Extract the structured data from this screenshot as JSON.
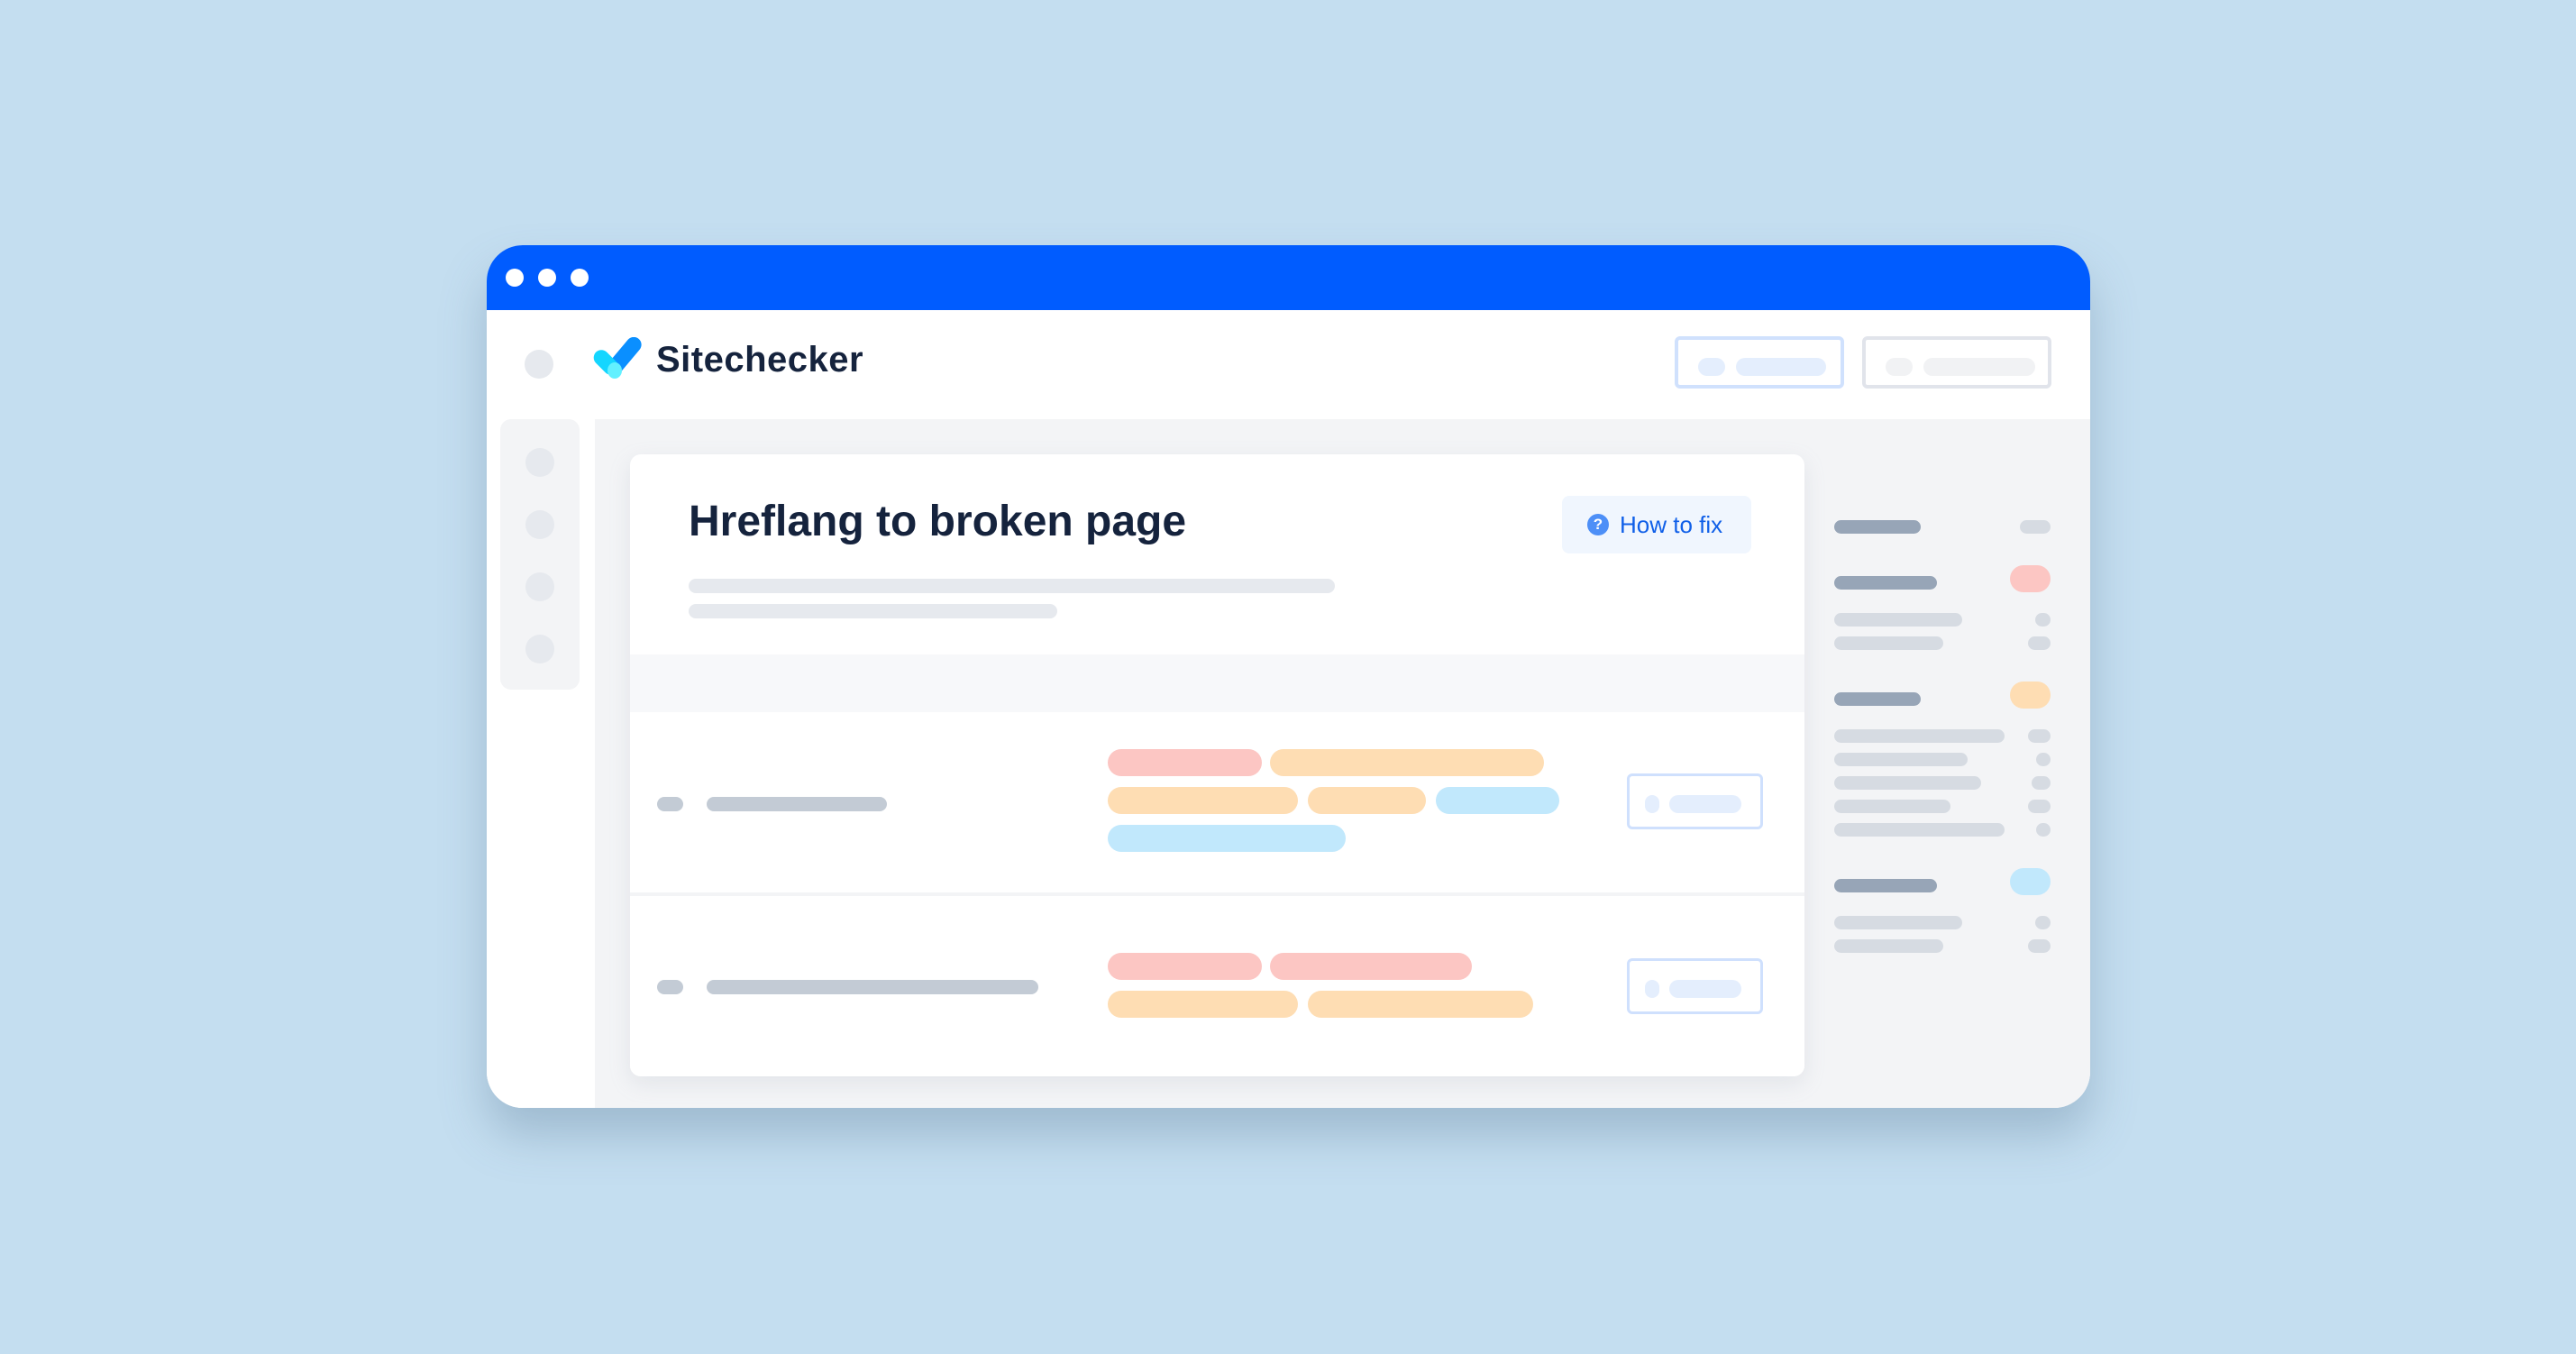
{
  "window": {
    "titlebar_color": "#005CFF",
    "traffic_dots": [
      "dot",
      "dot",
      "dot"
    ]
  },
  "header": {
    "logo_text": "Sitechecker",
    "logo_icon": "checkmark-logo-icon",
    "buttons": [
      {
        "name": "header-button-primary",
        "state": "highlighted"
      },
      {
        "name": "header-button-secondary",
        "state": "default"
      }
    ]
  },
  "sidebar": {
    "items": [
      "nav-item-1",
      "nav-item-2",
      "nav-item-3",
      "nav-item-4"
    ]
  },
  "issue": {
    "title": "Hreflang to broken page",
    "how_to_fix_label": "How to fix",
    "help_icon_glyph": "?"
  },
  "table": {
    "rows": [
      {
        "tags": [
          [
            "pink",
            "orange"
          ],
          [
            "orange",
            "orange",
            "blue"
          ],
          [
            "blue"
          ]
        ]
      },
      {
        "tags": [
          [
            "pink",
            "pink"
          ],
          [
            "orange",
            "orange"
          ]
        ]
      }
    ]
  },
  "right_panel": {
    "groups": [
      {
        "badge": "none",
        "lines": 0
      },
      {
        "badge": "pink",
        "lines": 2
      },
      {
        "badge": "orange",
        "lines": 5
      },
      {
        "badge": "blue",
        "lines": 2
      }
    ]
  },
  "colors": {
    "accent": "#005CFF",
    "link": "#0F5FE8",
    "title": "#15233D",
    "tag_pink": "#FCC6C3",
    "tag_orange": "#FEDDB3",
    "tag_blue": "#C1E8FC",
    "background": "#C4DEF0"
  }
}
